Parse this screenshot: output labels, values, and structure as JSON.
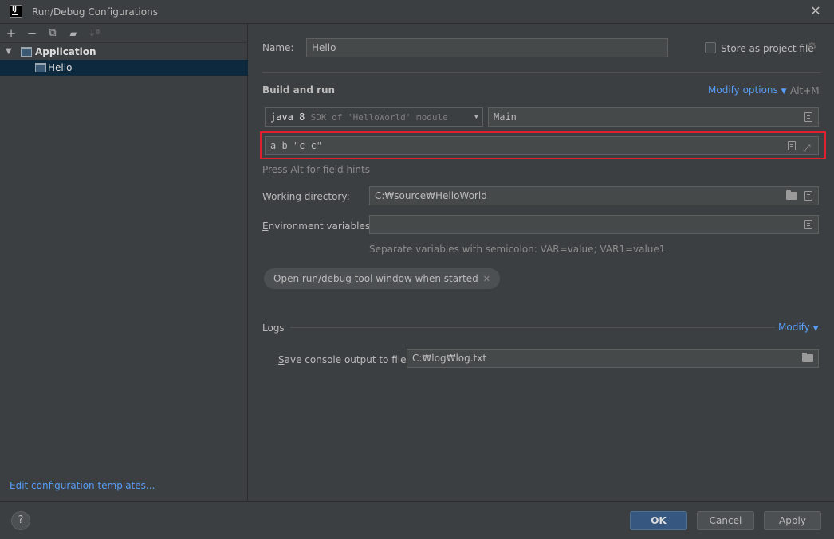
{
  "window": {
    "title": "Run/Debug Configurations",
    "logo_text": "IJ"
  },
  "toolbar": {
    "add": "+",
    "remove": "−",
    "copy": "⧉",
    "folder": "▰",
    "sort": "↓ª"
  },
  "tree": {
    "group_label": "Application",
    "item_label": "Hello"
  },
  "edit_templates_link": "Edit configuration templates...",
  "name_field": {
    "label": "Name:",
    "value": "Hello"
  },
  "store_as_project": {
    "label": "Store as project file",
    "checked": false
  },
  "build_and_run": {
    "heading": "Build and run",
    "modify_options": "Modify options",
    "shortcut": "Alt+M",
    "jdk_main": "java 8",
    "jdk_sub": "SDK of 'HelloWorld' module",
    "main_class": "Main",
    "program_args": "a b \"c c\"",
    "hint": "Press Alt for field hints"
  },
  "working_directory": {
    "label": "Working directory:",
    "value": "C:₩source₩HelloWorld"
  },
  "env_vars": {
    "label": "Environment variables:",
    "value": "",
    "hint": "Separate variables with semicolon: VAR=value; VAR1=value1"
  },
  "chip": {
    "label": "Open run/debug tool window when started"
  },
  "logs": {
    "heading": "Logs",
    "modify": "Modify",
    "save_label": "Save console output to file:",
    "save_value": "C:₩log₩log.txt"
  },
  "buttons": {
    "help": "?",
    "ok": "OK",
    "cancel": "Cancel",
    "apply": "Apply"
  },
  "colors": {
    "accent_link": "#589df6",
    "highlight_box": "#e0202f",
    "selection": "#0d293e",
    "primary_button": "#365880"
  }
}
